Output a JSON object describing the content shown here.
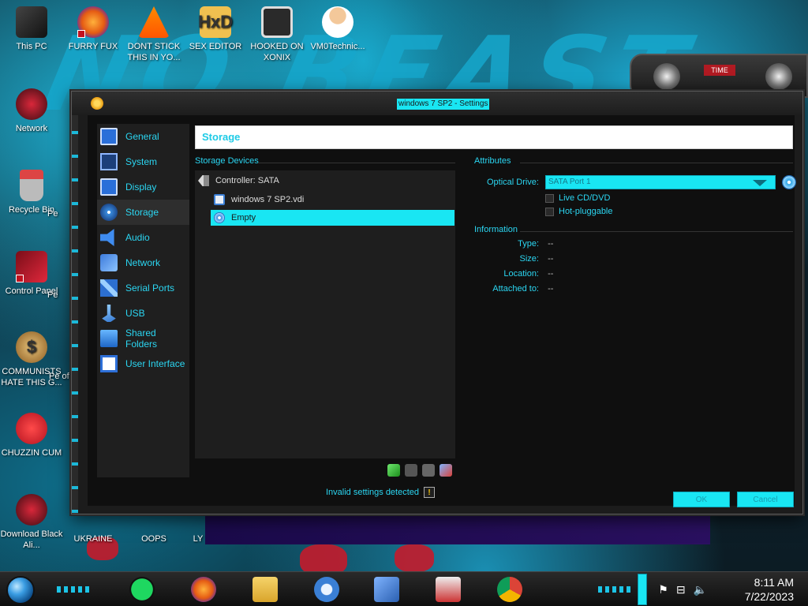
{
  "desktop": {
    "icons": [
      {
        "label": "This PC"
      },
      {
        "label": "FURRY FUX"
      },
      {
        "label": "DONT STICK THIS IN YO..."
      },
      {
        "label": "SEX EDITOR"
      },
      {
        "label": "HOOKED ON XONIX"
      },
      {
        "label": "VM0Technic..."
      },
      {
        "label": "Network"
      },
      {
        "label": "Recycle Bin"
      },
      {
        "label": "Pe"
      },
      {
        "label": "Control Panel"
      },
      {
        "label": "Pe"
      },
      {
        "label": "COMMUNISTS HATE THIS G..."
      },
      {
        "label": "Pe of"
      },
      {
        "label": "CHUZZIN CUM"
      },
      {
        "label": "Download Black Ali..."
      },
      {
        "label": "UKRAINE"
      },
      {
        "label": "OOPS"
      },
      {
        "label": "LY"
      }
    ],
    "alien_label": "TIME"
  },
  "window": {
    "title": "windows 7 SP2 - Settings",
    "sidebar": [
      {
        "label": "General",
        "icon": "monitor-icon"
      },
      {
        "label": "System",
        "icon": "chip-icon"
      },
      {
        "label": "Display",
        "icon": "monitor-icon"
      },
      {
        "label": "Storage",
        "icon": "disk-icon",
        "active": true
      },
      {
        "label": "Audio",
        "icon": "speaker-icon"
      },
      {
        "label": "Network",
        "icon": "network-icon"
      },
      {
        "label": "Serial Ports",
        "icon": "serial-port-icon"
      },
      {
        "label": "USB",
        "icon": "usb-icon"
      },
      {
        "label": "Shared Folders",
        "icon": "folder-icon"
      },
      {
        "label": "User Interface",
        "icon": "user-interface-icon"
      }
    ],
    "header": "Storage",
    "storage_devices": {
      "label": "Storage Devices",
      "controller": "Controller: SATA",
      "items": [
        {
          "label": "windows 7 SP2.vdi",
          "icon": "hard-disk-icon"
        },
        {
          "label": "Empty",
          "icon": "optical-disc-icon",
          "selected": true
        }
      ]
    },
    "attributes": {
      "label": "Attributes",
      "optical_drive_label": "Optical Drive:",
      "optical_drive_value": "SATA Port 1",
      "live_cd_label": "Live CD/DVD",
      "hot_pluggable_label": "Hot-pluggable"
    },
    "information": {
      "label": "Information",
      "rows": [
        {
          "label": "Type:",
          "value": "--"
        },
        {
          "label": "Size:",
          "value": "--"
        },
        {
          "label": "Location:",
          "value": "--"
        },
        {
          "label": "Attached to:",
          "value": "--"
        }
      ]
    },
    "status": "Invalid settings detected",
    "ok_label": "OK",
    "cancel_label": "Cancel"
  },
  "taskbar": {
    "time": "8:11 AM",
    "date": "7/22/2023"
  },
  "colors": {
    "accent": "#19e6f3",
    "label_text": "#2bd6f2",
    "window_bg": "#0f0f0f"
  }
}
